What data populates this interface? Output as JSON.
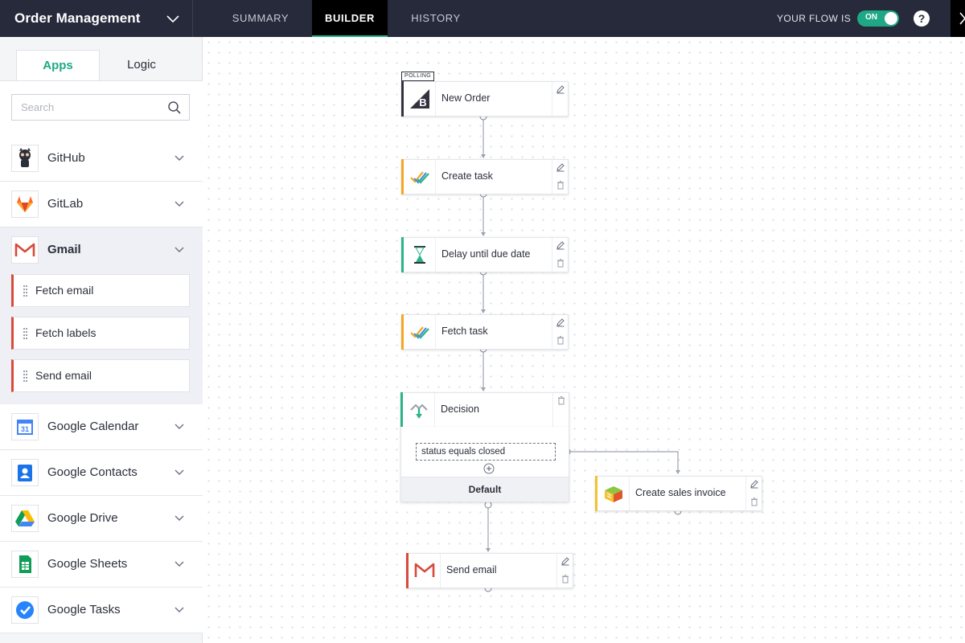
{
  "header": {
    "project_title": "Order Management",
    "tabs": [
      {
        "label": "SUMMARY",
        "active": false
      },
      {
        "label": "BUILDER",
        "active": true
      },
      {
        "label": "HISTORY",
        "active": false
      }
    ],
    "flow_status_label": "YOUR FLOW IS",
    "toggle_label": "ON",
    "help_label": "?"
  },
  "sidebar": {
    "tabs": [
      {
        "label": "Apps",
        "active": true
      },
      {
        "label": "Logic",
        "active": false
      }
    ],
    "search_placeholder": "Search",
    "apps": [
      {
        "name": "GitHub",
        "icon": "github-icon"
      },
      {
        "name": "GitLab",
        "icon": "gitlab-icon"
      },
      {
        "name": "Gmail",
        "icon": "gmail-icon",
        "expanded": true,
        "actions": [
          "Fetch email",
          "Fetch labels",
          "Send email"
        ]
      },
      {
        "name": "Google Calendar",
        "icon": "google-calendar-icon",
        "icon_text": "31"
      },
      {
        "name": "Google Contacts",
        "icon": "google-contacts-icon"
      },
      {
        "name": "Google Drive",
        "icon": "google-drive-icon"
      },
      {
        "name": "Google Sheets",
        "icon": "google-sheets-icon"
      },
      {
        "name": "Google Tasks",
        "icon": "google-tasks-icon"
      }
    ]
  },
  "canvas": {
    "trigger_badge": "POLLING",
    "nodes": [
      {
        "label": "New Order",
        "icon": "bigcommerce-icon"
      },
      {
        "label": "Create task",
        "icon": "tasks-check-icon"
      },
      {
        "label": "Delay until due date",
        "icon": "hourglass-icon"
      },
      {
        "label": "Fetch task",
        "icon": "tasks-check-icon"
      },
      {
        "label": "Decision",
        "icon": "decision-icon"
      },
      {
        "label": "Create sales invoice",
        "icon": "invoice-app-icon"
      },
      {
        "label": "Send email",
        "icon": "gmail-icon"
      }
    ],
    "decision": {
      "condition": "status equals closed",
      "default_label": "Default"
    }
  },
  "colors": {
    "topbar": "#262a3b",
    "accent_green": "#1fa885",
    "gmail_red": "#d94a3b",
    "task_orange": "#f5a623",
    "delay_green": "#2bb38a",
    "invoice_yellow": "#f2c230"
  }
}
